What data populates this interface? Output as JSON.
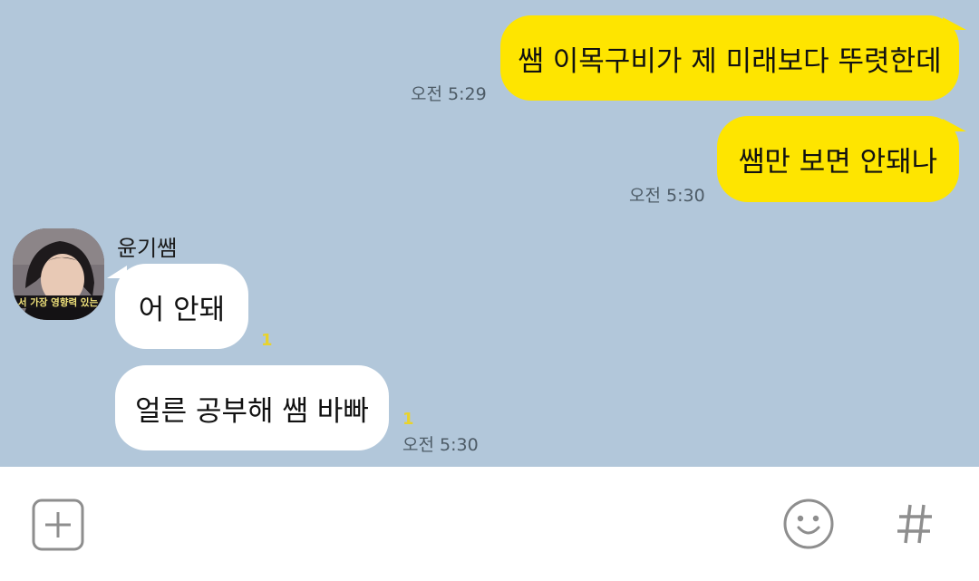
{
  "messages": [
    {
      "from": "me",
      "text": "쌤 이목구비가 제 미래보다 뚜렷한데",
      "time": "오전 5:29"
    },
    {
      "from": "me",
      "text": "쌤만 보면 안돼나",
      "time": "오전 5:30"
    },
    {
      "from": "them",
      "sender": "윤기쌤",
      "text": "어 안돼",
      "unread": "1"
    },
    {
      "from": "them",
      "text": "얼른 공부해 쌤 바빠",
      "unread": "1",
      "time": "오전 5:30"
    }
  ],
  "avatar": {
    "caption": "서 가장 영향력 있는"
  },
  "input_bar": {
    "add_icon": "plus-square-icon",
    "emoji_icon": "smiley-icon",
    "hash_icon": "hashtag-icon"
  },
  "colors": {
    "background": "#b2c7da",
    "my_bubble": "#fee500",
    "their_bubble": "#ffffff",
    "unread": "#e9d32a"
  }
}
